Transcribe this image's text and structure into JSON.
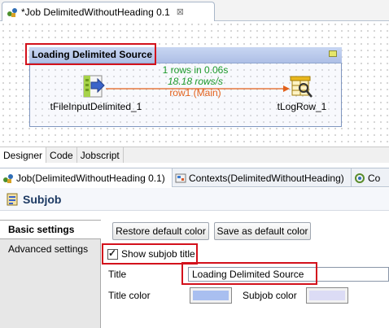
{
  "editor": {
    "tab_title": "*Job DelimitedWithoutHeading 0.1",
    "close_symbol": "⊠"
  },
  "canvas": {
    "subjob_title": "Loading Delimited Source",
    "component_source": {
      "label": "tFileInputDelimited_1",
      "icon": "file-input-delimited-icon"
    },
    "component_target": {
      "label": "tLogRow_1",
      "icon": "log-row-icon"
    },
    "flow": {
      "rows_text": "1 rows in 0.06s",
      "rate_text": "18.18 rows/s",
      "name": "row1 (Main)"
    }
  },
  "view_tabs": [
    "Designer",
    "Code",
    "Jobscript"
  ],
  "panel_tabs": [
    {
      "label": "Job(DelimitedWithoutHeading 0.1)",
      "icon": "job-icon"
    },
    {
      "label": "Contexts(DelimitedWithoutHeading)",
      "icon": "contexts-icon"
    },
    {
      "label": "Co",
      "icon": "component-icon"
    }
  ],
  "section": {
    "title": "Subjob",
    "icon": "subjob-icon"
  },
  "left_tabs": [
    "Basic settings",
    "Advanced settings"
  ],
  "settings": {
    "restore_button": "Restore default color",
    "save_button": "Save as default color",
    "show_title_label": "Show subjob title",
    "show_title_checked": true,
    "title_label": "Title",
    "title_value": "Loading Delimited Source",
    "title_color_label": "Title color",
    "subjob_color_label": "Subjob color"
  },
  "colors": {
    "highlight": "#d3111c",
    "title_color": "#a9bff0",
    "subjob_color": "#dcdcf5",
    "flow_stats": "#1d9a2b",
    "flow_name": "#e2601b"
  }
}
